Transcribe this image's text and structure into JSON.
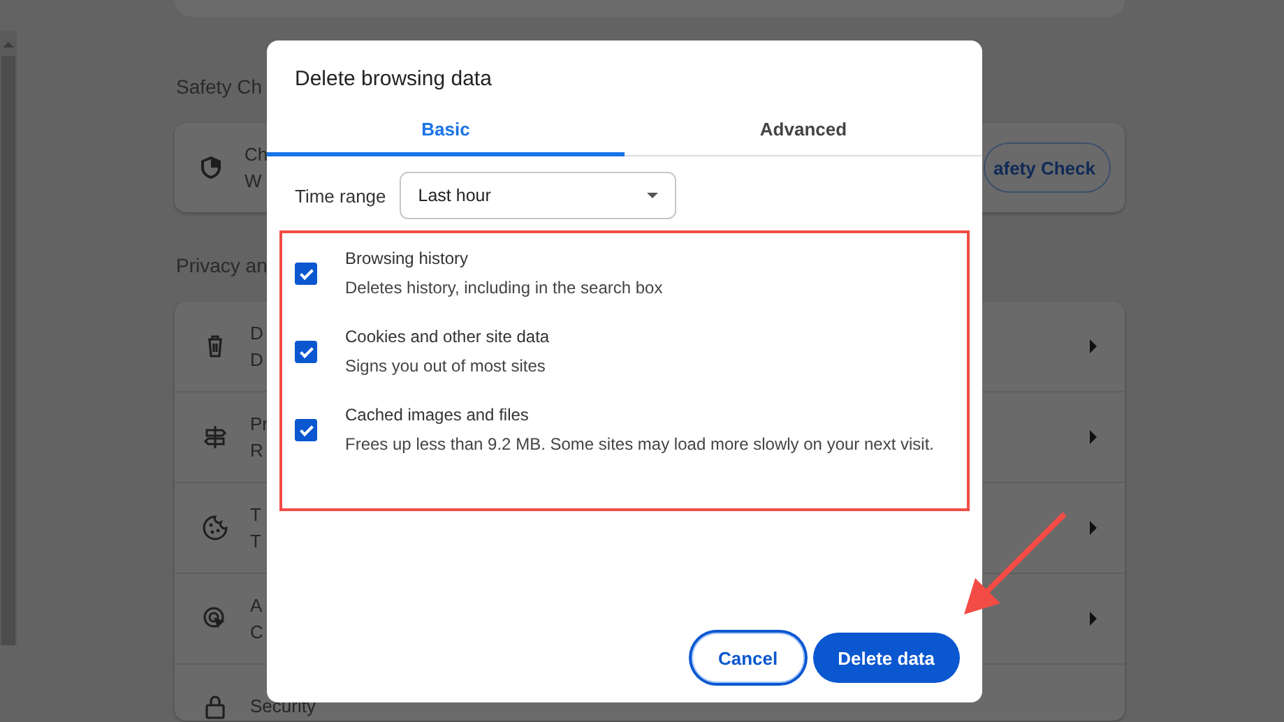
{
  "settings_page": {
    "safety_heading": "Safety Ch",
    "safety_card": {
      "title": "Ch",
      "subtitle": "W",
      "button": "afety Check"
    },
    "privacy_heading": "Privacy an",
    "privacy_rows": [
      {
        "title": "D",
        "subtitle": "D"
      },
      {
        "title": "Pr",
        "subtitle": "R"
      },
      {
        "title": "T",
        "subtitle": "T"
      },
      {
        "title": "A",
        "subtitle": "C"
      },
      {
        "title": "Security"
      }
    ]
  },
  "dialog": {
    "title": "Delete browsing data",
    "tabs": [
      {
        "label": "Basic",
        "selected": true
      },
      {
        "label": "Advanced",
        "selected": false
      }
    ],
    "time_range": {
      "label": "Time range",
      "value": "Last hour"
    },
    "options": [
      {
        "title": "Browsing history",
        "description": "Deletes history, including in the search box",
        "checked": true
      },
      {
        "title": "Cookies and other site data",
        "description": "Signs you out of most sites",
        "checked": true
      },
      {
        "title": "Cached images and files",
        "description": "Frees up less than 9.2 MB. Some sites may load more slowly on your next visit.",
        "checked": true
      }
    ],
    "buttons": [
      {
        "label": "Cancel",
        "kind": "secondary"
      },
      {
        "label": "Delete data",
        "kind": "primary"
      }
    ]
  }
}
